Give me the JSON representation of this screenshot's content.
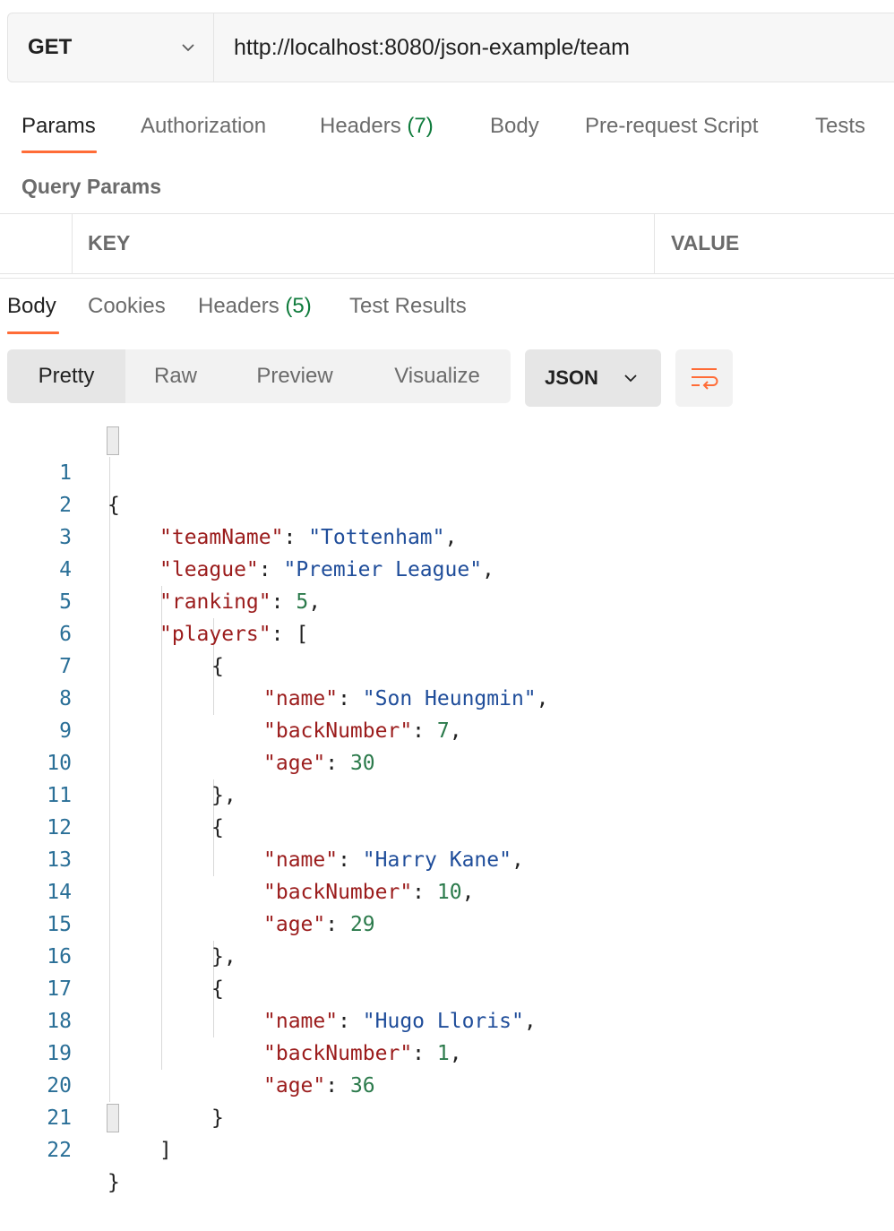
{
  "request": {
    "method": "GET",
    "url": "http://localhost:8080/json-example/team"
  },
  "request_tabs": {
    "params": "Params",
    "authorization": "Authorization",
    "headers_label": "Headers",
    "headers_count": "(7)",
    "body": "Body",
    "prerequest": "Pre-request Script",
    "tests": "Tests"
  },
  "query_params": {
    "title": "Query Params",
    "key_header": "KEY",
    "value_header": "VALUE"
  },
  "response_tabs": {
    "body": "Body",
    "cookies": "Cookies",
    "headers_label": "Headers",
    "headers_count": "(5)",
    "test_results": "Test Results"
  },
  "view_modes": {
    "pretty": "Pretty",
    "raw": "Raw",
    "preview": "Preview",
    "visualize": "Visualize"
  },
  "format": "JSON",
  "icons": {
    "method_dropdown": "chevron-down-icon",
    "format_dropdown": "chevron-down-icon",
    "wrap": "text-wrap-icon"
  },
  "colors": {
    "accent": "#ff6c37",
    "json_key": "#9b1c1c",
    "json_string": "#1f4d9a",
    "json_number": "#2b7a4b",
    "line_number": "#2a6f97",
    "count": "#0f7b3c"
  },
  "code": {
    "line_numbers": [
      "1",
      "2",
      "3",
      "4",
      "5",
      "6",
      "7",
      "8",
      "9",
      "10",
      "11",
      "12",
      "13",
      "14",
      "15",
      "16",
      "17",
      "18",
      "19",
      "20",
      "21",
      "22"
    ],
    "punct": {
      "open_brace": "{",
      "close_brace": "}",
      "close_brace_comma": "},",
      "open_bracket": "[",
      "close_bracket": "]",
      "colon": ": ",
      "comma": ","
    },
    "team": {
      "teamName_key": "\"teamName\"",
      "teamName_value": "\"Tottenham\"",
      "league_key": "\"league\"",
      "league_value": "\"Premier League\"",
      "ranking_key": "\"ranking\"",
      "ranking_value": "5",
      "players_key": "\"players\""
    },
    "players": [
      {
        "name_key": "\"name\"",
        "name_value": "\"Son Heungmin\"",
        "backNumber_key": "\"backNumber\"",
        "backNumber_value": "7",
        "age_key": "\"age\"",
        "age_value": "30"
      },
      {
        "name_key": "\"name\"",
        "name_value": "\"Harry Kane\"",
        "backNumber_key": "\"backNumber\"",
        "backNumber_value": "10",
        "age_key": "\"age\"",
        "age_value": "29"
      },
      {
        "name_key": "\"name\"",
        "name_value": "\"Hugo Lloris\"",
        "backNumber_key": "\"backNumber\"",
        "backNumber_value": "1",
        "age_key": "\"age\"",
        "age_value": "36"
      }
    ]
  }
}
